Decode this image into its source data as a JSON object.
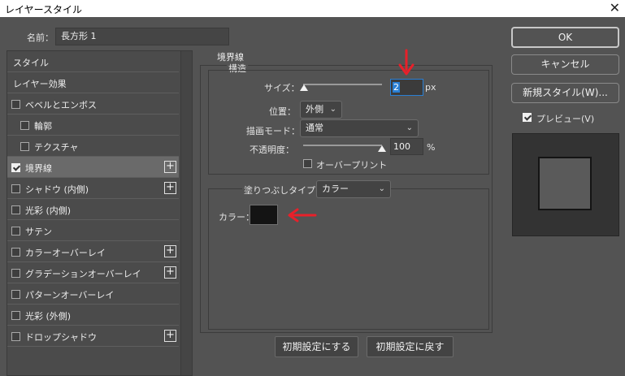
{
  "window": {
    "title": "レイヤースタイル",
    "close_glyph": "✕"
  },
  "name_field": {
    "label": "名前：",
    "value": "長方形 1"
  },
  "sidebar": {
    "items": [
      {
        "label": "スタイル",
        "checkbox": false,
        "checked": false,
        "plus": false,
        "active": false
      },
      {
        "label": "レイヤー効果",
        "checkbox": false,
        "checked": false,
        "plus": false,
        "active": false
      },
      {
        "label": "ベベルとエンボス",
        "checkbox": true,
        "checked": false,
        "plus": false,
        "active": false
      },
      {
        "label": "輪郭",
        "checkbox": true,
        "checked": false,
        "plus": false,
        "active": false,
        "indent": true
      },
      {
        "label": "テクスチャ",
        "checkbox": true,
        "checked": false,
        "plus": false,
        "active": false,
        "indent": true
      },
      {
        "label": "境界線",
        "checkbox": true,
        "checked": true,
        "plus": true,
        "active": true
      },
      {
        "label": "シャドウ (内側)",
        "checkbox": true,
        "checked": false,
        "plus": true,
        "active": false
      },
      {
        "label": "光彩 (内側)",
        "checkbox": true,
        "checked": false,
        "plus": false,
        "active": false
      },
      {
        "label": "サテン",
        "checkbox": true,
        "checked": false,
        "plus": false,
        "active": false
      },
      {
        "label": "カラーオーバーレイ",
        "checkbox": true,
        "checked": false,
        "plus": true,
        "active": false
      },
      {
        "label": "グラデーションオーバーレイ",
        "checkbox": true,
        "checked": false,
        "plus": true,
        "active": false
      },
      {
        "label": "パターンオーバーレイ",
        "checkbox": true,
        "checked": false,
        "plus": false,
        "active": false
      },
      {
        "label": "光彩 (外側)",
        "checkbox": true,
        "checked": false,
        "plus": false,
        "active": false
      },
      {
        "label": "ドロップシャドウ",
        "checkbox": true,
        "checked": false,
        "plus": true,
        "active": false
      }
    ]
  },
  "stroke": {
    "title": "境界線",
    "structure_label": "構造",
    "size_label": "サイズ：",
    "size_value": "2",
    "size_unit": "px",
    "position_label": "位置：",
    "position_value": "外側",
    "blend_label": "描画モード：",
    "blend_value": "通常",
    "opacity_label": "不透明度：",
    "opacity_value": "100",
    "opacity_unit": "%",
    "overprint_label": "オーバープリント",
    "fill_type_label": "塗りつぶしタイプ：",
    "fill_type_value": "カラー",
    "color_label": "カラー：",
    "color_value": "#141414"
  },
  "buttons": {
    "ok": "OK",
    "cancel": "キャンセル",
    "new_style": "新規スタイル(W)...",
    "preview_label": "プレビュー(V)",
    "make_default": "初期設定にする",
    "reset_default": "初期設定に戻す"
  },
  "colors": {
    "annotation_arrow": "#e8202a"
  }
}
